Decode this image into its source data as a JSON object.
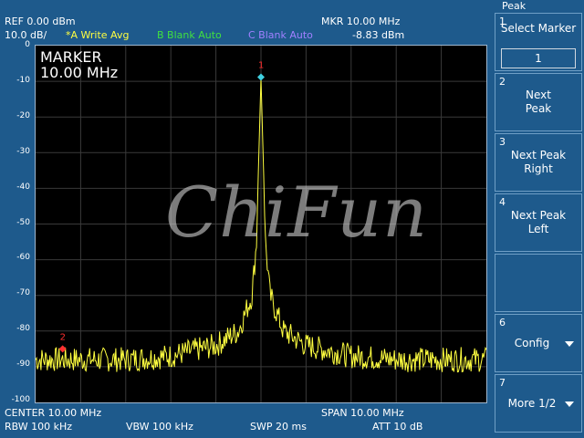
{
  "header": {
    "ref": "REF  0.00 dBm",
    "scale": "10.0 dB/",
    "trace_a": "*A Write Avg",
    "trace_b": "B Blank Auto",
    "trace_c": "C Blank Auto",
    "mkr_freq": "MKR 10.00 MHz",
    "mkr_level": "-8.83 dBm"
  },
  "plot": {
    "marker_title": "MARKER",
    "marker_freq": "10.00 MHz",
    "marker1_label": "1",
    "marker2_label": "2",
    "yticks": [
      "0",
      "-10",
      "-20",
      "-30",
      "-40",
      "-50",
      "-60",
      "-70",
      "-80",
      "-90",
      "-100"
    ]
  },
  "watermark": "ChiFun",
  "footer": {
    "center": "CENTER 10.00 MHz",
    "span": "SPAN 10.00 MHz",
    "rbw": "RBW 100 kHz",
    "vbw": "VBW  100 kHz",
    "swp": "SWP  20 ms",
    "att": "ATT 10 dB"
  },
  "softkeys": {
    "title": "Peak",
    "k1_num": "1",
    "k1_label": "Select Marker",
    "k1_value": "1",
    "k2_num": "2",
    "k2_label1": "Next",
    "k2_label2": "Peak",
    "k3_num": "3",
    "k3_label1": "Next Peak",
    "k3_label2": "Right",
    "k4_num": "4",
    "k4_label1": "Next Peak",
    "k4_label2": "Left",
    "k5_num": "",
    "k6_num": "6",
    "k6_label": "Config",
    "k7_num": "7",
    "k7_label": "More 1/2"
  },
  "chart_data": {
    "type": "line",
    "trace_color": "#ffff40",
    "ylim": [
      -100,
      0
    ],
    "y_unit": "dBm",
    "x_center_mhz": 10.0,
    "x_span_mhz": 10.0,
    "series": [
      {
        "x": [
          5,
          7,
          8,
          9,
          9.5,
          9.8,
          9.9,
          10,
          10.1,
          10.2,
          10.5,
          11,
          12,
          13,
          15
        ],
        "values": [
          -88,
          -88,
          -87,
          -84,
          -80,
          -70,
          -55,
          -9,
          -55,
          -70,
          -80,
          -84,
          -87,
          -88,
          -88
        ]
      }
    ],
    "markers": [
      {
        "label": "1",
        "x": 10.0,
        "y": -8.83
      },
      {
        "label": "2",
        "x": 5.6,
        "y": -85
      }
    ]
  }
}
